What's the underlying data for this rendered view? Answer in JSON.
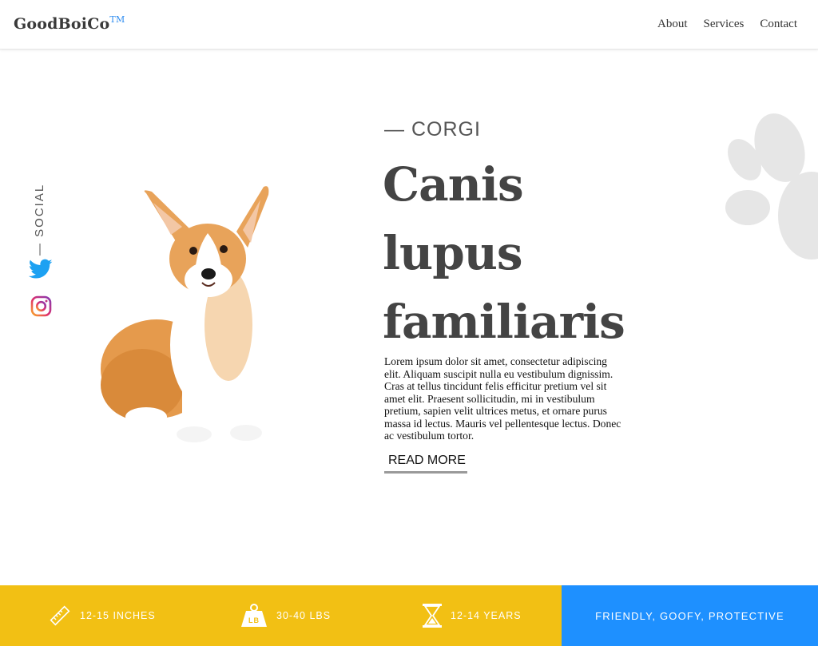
{
  "header": {
    "brand": "GoodBoiCo",
    "brand_mark": "TM",
    "nav": [
      {
        "label": "About"
      },
      {
        "label": "Services"
      },
      {
        "label": "Contact"
      }
    ]
  },
  "social": {
    "label": "— SOCIAL",
    "icons": [
      "twitter-icon",
      "instagram-icon"
    ]
  },
  "hero": {
    "breed": "— CORGI",
    "title_lines": [
      "Canis",
      "lupus",
      "familiaris"
    ],
    "description": "Lorem ipsum dolor sit amet, consectetur adipiscing elit. Aliquam suscipit nulla eu vestibulum dignissim. Cras at tellus tincidunt felis efficitur pretium vel sit amet elit. Praesent sollicitudin, mi in vestibulum pretium, sapien velit ultrices metus, et ornare purus massa id lectus. Mauris vel pellentesque lectus. Donec ac vestibulum tortor.",
    "read_more": "READ MORE"
  },
  "stats": {
    "height": "12-15 INCHES",
    "weight_badge": "LB",
    "weight": "30-40 LBS",
    "lifespan": "12-14 YEARS",
    "temperament": "FRIENDLY, GOOFY, PROTECTIVE"
  },
  "colors": {
    "stats_bg": "#f2c014",
    "temperament_bg": "#1e90ff",
    "brand_mark": "#2d8cf0",
    "twitter": "#1da1f2"
  }
}
